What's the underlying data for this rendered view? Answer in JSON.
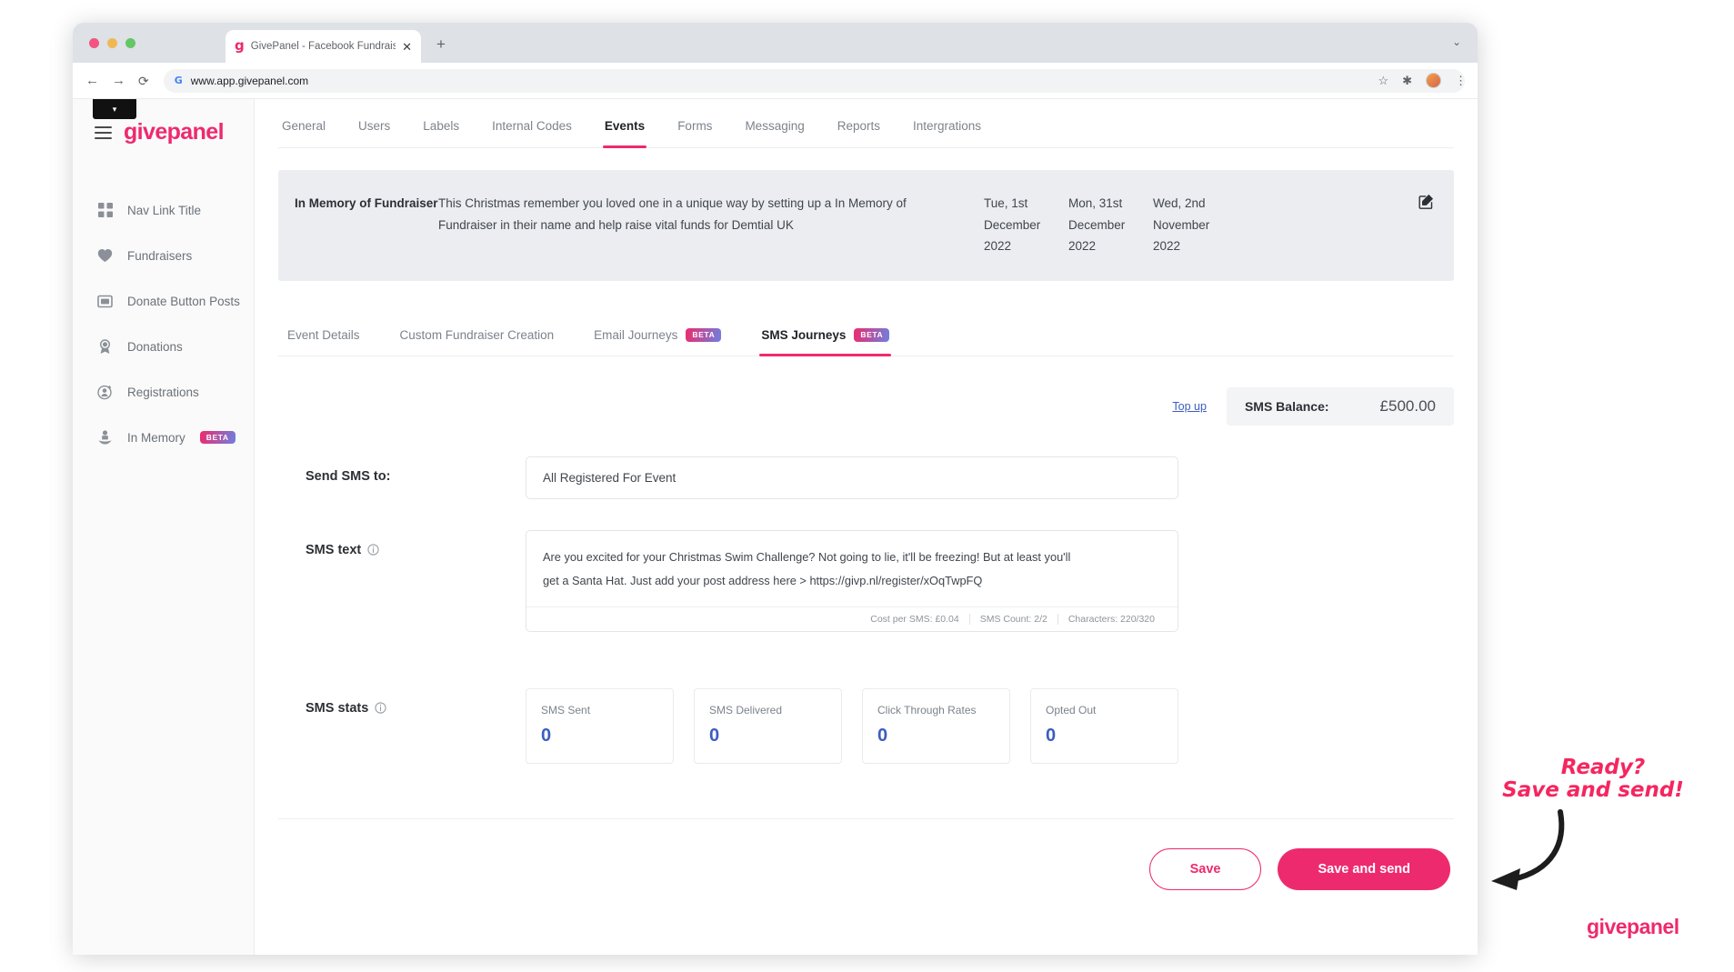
{
  "browser": {
    "tab_title": "GivePanel - Facebook Fundraising",
    "tab_favicon": "g",
    "new_tab_label": "+",
    "close_label": "✕",
    "window_chevron": "⌄",
    "back_label": "←",
    "forward_label": "→",
    "reload_label": "⟳",
    "site_glyph": "G",
    "url": "www.app.givepanel.com",
    "star_label": "☆",
    "extensions_label": "✱",
    "menu_label": "⋮"
  },
  "sidebar": {
    "brand": "givepanel",
    "items": [
      {
        "label": "Nav Link Title",
        "icon": "grid-icon",
        "badge": ""
      },
      {
        "label": "Fundraisers",
        "icon": "heart-icon",
        "badge": ""
      },
      {
        "label": "Donate Button Posts",
        "icon": "card-icon",
        "badge": ""
      },
      {
        "label": "Donations",
        "icon": "ribbon-icon",
        "badge": ""
      },
      {
        "label": "Registrations",
        "icon": "user-add-icon",
        "badge": ""
      },
      {
        "label": "In Memory",
        "icon": "memorial-icon",
        "badge": "BETA"
      }
    ]
  },
  "top_tabs": [
    {
      "label": "General",
      "active": false
    },
    {
      "label": "Users",
      "active": false
    },
    {
      "label": "Labels",
      "active": false
    },
    {
      "label": "Internal Codes",
      "active": false
    },
    {
      "label": "Events",
      "active": true
    },
    {
      "label": "Forms",
      "active": false
    },
    {
      "label": "Messaging",
      "active": false
    },
    {
      "label": "Reports",
      "active": false
    },
    {
      "label": "Intergrations",
      "active": false
    }
  ],
  "event": {
    "name": "In Memory of Fundraiser",
    "description": "This Christmas remember you loved one in a unique way by setting up a In Memory of Fundraiser in their name and help raise vital funds for Demtial UK",
    "dates": [
      "Tue, 1st December 2022",
      "Mon, 31st December 2022",
      "Wed, 2nd November 2022"
    ]
  },
  "sub_tabs": [
    {
      "label": "Event Details",
      "badge": "",
      "active": false
    },
    {
      "label": "Custom Fundraiser Creation",
      "badge": "",
      "active": false
    },
    {
      "label": "Email Journeys",
      "badge": "BETA",
      "active": false
    },
    {
      "label": "SMS Journeys",
      "badge": "BETA",
      "active": true
    }
  ],
  "balance": {
    "top_up_label": "Top up",
    "label": "SMS Balance:",
    "value": "£500.00"
  },
  "send_to": {
    "label": "Send SMS to:",
    "value": "All Registered For Event"
  },
  "sms_text": {
    "label": "SMS text",
    "line1": "Are you excited for your Christmas Swim Challenge? Not going to lie, it'll be freezing! But at least you'll",
    "line2": "get a Santa Hat. Just add your post address here > https://givp.nl/register/xOqTwpFQ",
    "meta_cost": "Cost per SMS: £0.04",
    "meta_count": "SMS Count: 2/2",
    "meta_chars": "Characters:  220/320"
  },
  "sms_stats": {
    "label": "SMS stats",
    "cards": [
      {
        "label": "SMS Sent",
        "value": "0"
      },
      {
        "label": "SMS Delivered",
        "value": "0"
      },
      {
        "label": "Click Through Rates",
        "value": "0"
      },
      {
        "label": "Opted Out",
        "value": "0"
      }
    ]
  },
  "actions": {
    "save_label": "Save",
    "save_send_label": "Save and send"
  },
  "annotation": {
    "line1": "Ready?",
    "line2": "Save and send!",
    "brand": "givepanel"
  },
  "colors": {
    "accent": "#ee2a6e",
    "annotation": "#f5265f",
    "stat_value": "#3c5dc0",
    "link": "#3c5dc0"
  }
}
